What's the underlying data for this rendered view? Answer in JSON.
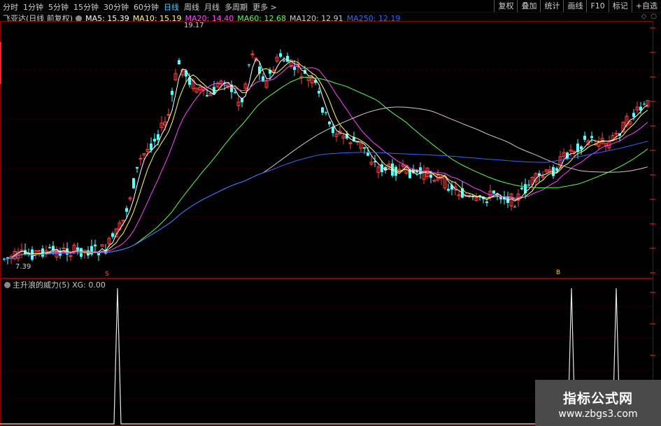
{
  "toolbar": {
    "periods": [
      "分时",
      "1分钟",
      "5分钟",
      "15分钟",
      "30分钟",
      "60分钟",
      "日线",
      "周线",
      "月线",
      "多周期",
      "更多 >"
    ],
    "active_period": "日线",
    "right_buttons": [
      "复权",
      "叠加",
      "统计",
      "画线",
      "F10",
      "标记",
      "+自选"
    ]
  },
  "stock": {
    "title": "飞亚达(日线 前复权)"
  },
  "ma_legend": [
    {
      "label": "MA5: 15.39",
      "color": "#ffffff"
    },
    {
      "label": "MA10: 15.19",
      "color": "#ffff66"
    },
    {
      "label": "MA20: 14.40",
      "color": "#ff44ff"
    },
    {
      "label": "MA60: 12.68",
      "color": "#55ff55"
    },
    {
      "label": "MA120: 12.91",
      "color": "#cccccc"
    },
    {
      "label": "MA250: 12.19",
      "color": "#3366ff"
    }
  ],
  "price_labels": {
    "high": "19.17",
    "low": "7.39"
  },
  "markers": {
    "s_marker": "S",
    "b_marker": "B"
  },
  "indicator": {
    "legend": "主升浪的威力(5)  XG: 0.00"
  },
  "watermark": {
    "title": "指标公式网",
    "url": "www.zbgs3.com"
  },
  "colors": {
    "up": "#ff4040",
    "down": "#54ffff",
    "grid": "#5a0000",
    "axis": "#8b0000"
  }
}
